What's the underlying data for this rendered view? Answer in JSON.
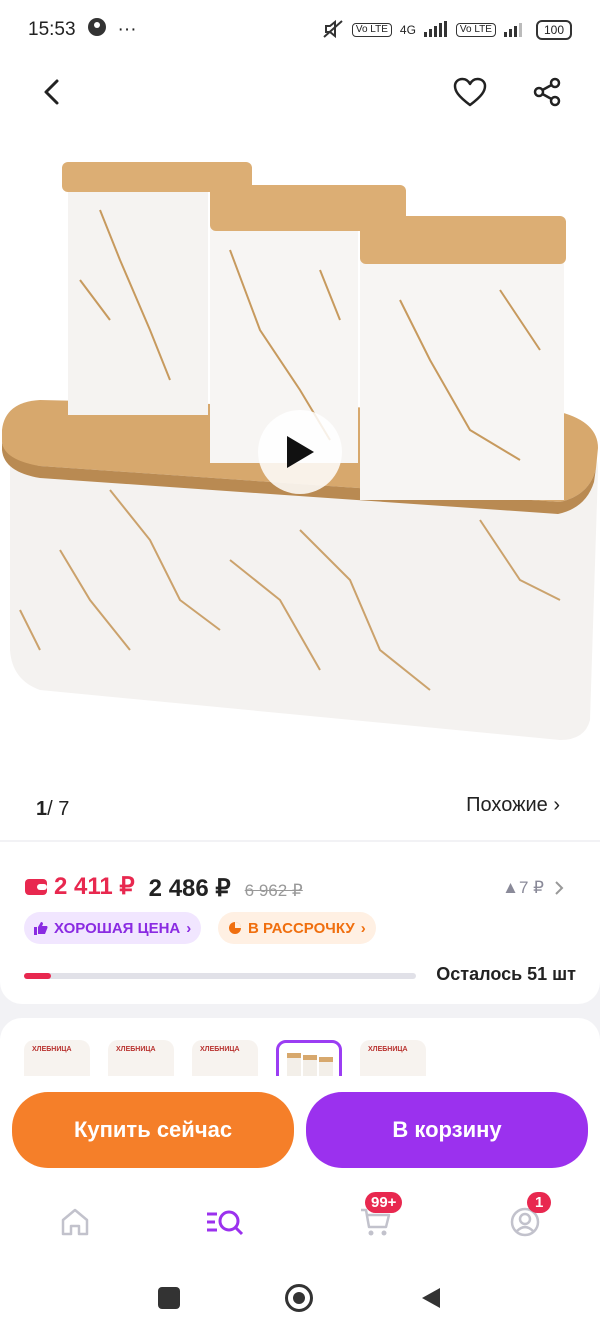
{
  "status_bar": {
    "time": "15:53",
    "dots": "···",
    "volte1": "Vo LTE",
    "net": "4G",
    "volte2": "Vo LTE",
    "battery": "100"
  },
  "gallery": {
    "current": "1",
    "total": "/ 7",
    "similar_label": "Похожие ›"
  },
  "price": {
    "wallet_price": "2 411 ₽",
    "price": "2 486 ₽",
    "old_price": "6 962 ₽",
    "delta": "▲7 ₽",
    "badge_good": "ХОРОШАЯ ЦЕНА",
    "badge_installment": "В РАССРОЧКУ",
    "stock_fraction": 0.07,
    "remaining": "Осталось 51 шт"
  },
  "variants": {
    "thumb_title": "ХЛЕБНИЦА"
  },
  "actions": {
    "buy_now": "Купить сейчас",
    "add_to_cart": "В корзину"
  },
  "nav": {
    "cart_badge": "99+",
    "profile_badge": "1"
  },
  "colors": {
    "accent_purple": "#9b31ee",
    "accent_orange": "#f57f29",
    "accent_red": "#e8284f"
  }
}
